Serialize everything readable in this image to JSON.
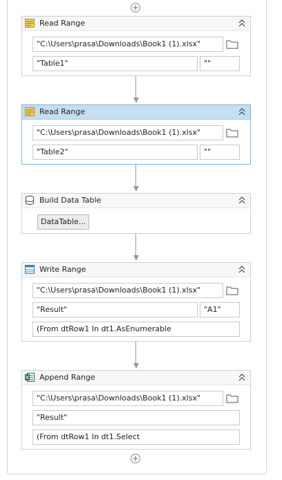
{
  "sequence": {
    "add_symbol": "+",
    "activities": [
      {
        "title": "Read Range",
        "icon": "excel-read-range-icon",
        "selected": false,
        "workbook_path": "\"C:\\Users\\prasa\\Downloads\\Book1 (1).xlsx\"",
        "sheet": "\"Table1\"",
        "range": "\"\""
      },
      {
        "title": "Read Range",
        "icon": "excel-read-range-icon",
        "selected": true,
        "workbook_path": "\"C:\\Users\\prasa\\Downloads\\Book1 (1).xlsx\"",
        "sheet": "\"Table2\"",
        "range": "\"\""
      },
      {
        "title": "Build Data Table",
        "icon": "database-icon",
        "button_label": "DataTable..."
      },
      {
        "title": "Write Range",
        "icon": "table-icon",
        "workbook_path": "\"C:\\Users\\prasa\\Downloads\\Book1 (1).xlsx\"",
        "sheet": "\"Result\"",
        "start_cell": "\"A1\"",
        "data": "(From dtRow1 In dt1.AsEnumerable"
      },
      {
        "title": "Append Range",
        "icon": "excel-append-icon",
        "workbook_path": "\"C:\\Users\\prasa\\Downloads\\Book1 (1).xlsx\"",
        "sheet": "\"Result\"",
        "data": "(From dtRow1 In dt1.Select"
      }
    ]
  },
  "colors": {
    "selected_header": "#c6def2",
    "header": "#f7f7f7",
    "border": "#d0d0d0",
    "excel_green": "#217346"
  }
}
